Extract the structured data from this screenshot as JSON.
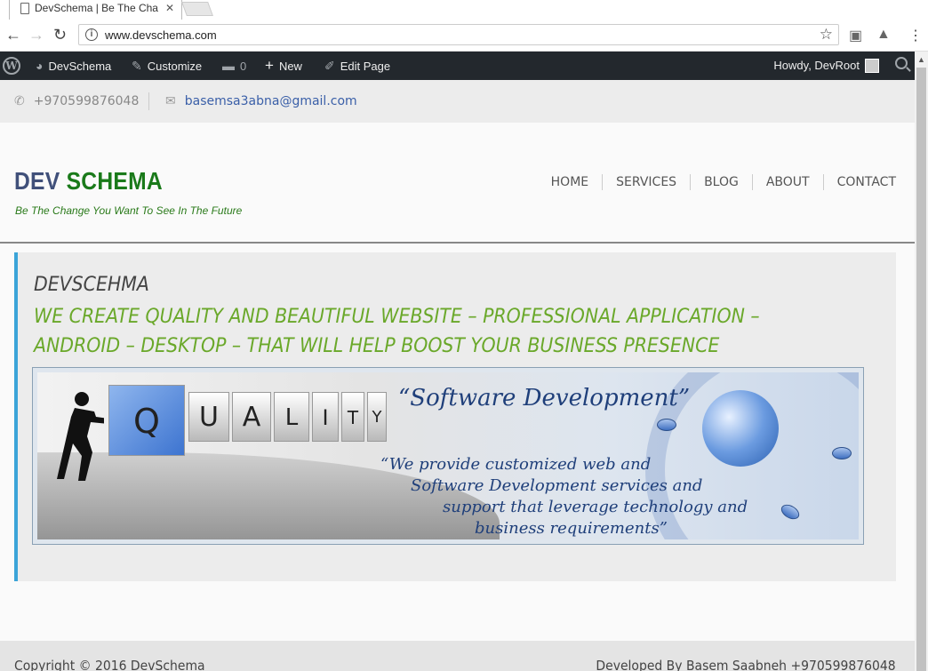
{
  "browser": {
    "tab_title": "DevSchema | Be The Cha",
    "url": "www.devschema.com"
  },
  "adminbar": {
    "site_name": "DevSchema",
    "customize": "Customize",
    "comments_count": "0",
    "new": "New",
    "edit_page": "Edit Page",
    "howdy": "Howdy, DevRoot"
  },
  "topbar": {
    "phone": "+970599876048",
    "email": "basemsa3abna@gmail.com"
  },
  "header": {
    "logo_dev": "DEV",
    "logo_schema": "SCHEMA",
    "tagline": "Be The Change You Want To See In The Future",
    "menu": [
      "HOME",
      "SERVICES",
      "BLOG",
      "ABOUT",
      "CONTACT"
    ]
  },
  "content": {
    "site_name": "DEVSCEHMA",
    "mission": "WE CREATE QUALITY AND BEAUTIFUL WEBSITE – PROFESSIONAL APPLICATION – ANDROID – DESKTOP – THAT WILL HELP BOOST YOUR BUSINESS PRESENCE",
    "banner": {
      "letters": [
        "Q",
        "U",
        "A",
        "L",
        "I",
        "T",
        "Y"
      ],
      "headline": "“Software Development”",
      "desc_lines": [
        "“We provide customized web and",
        "Software Development services and",
        "support that leverage technology and",
        "business requirements”"
      ]
    }
  },
  "footer": {
    "copyright": "Copyright © 2016 DevSchema",
    "credit": "Developed By Basem Saabneh +970599876048"
  }
}
